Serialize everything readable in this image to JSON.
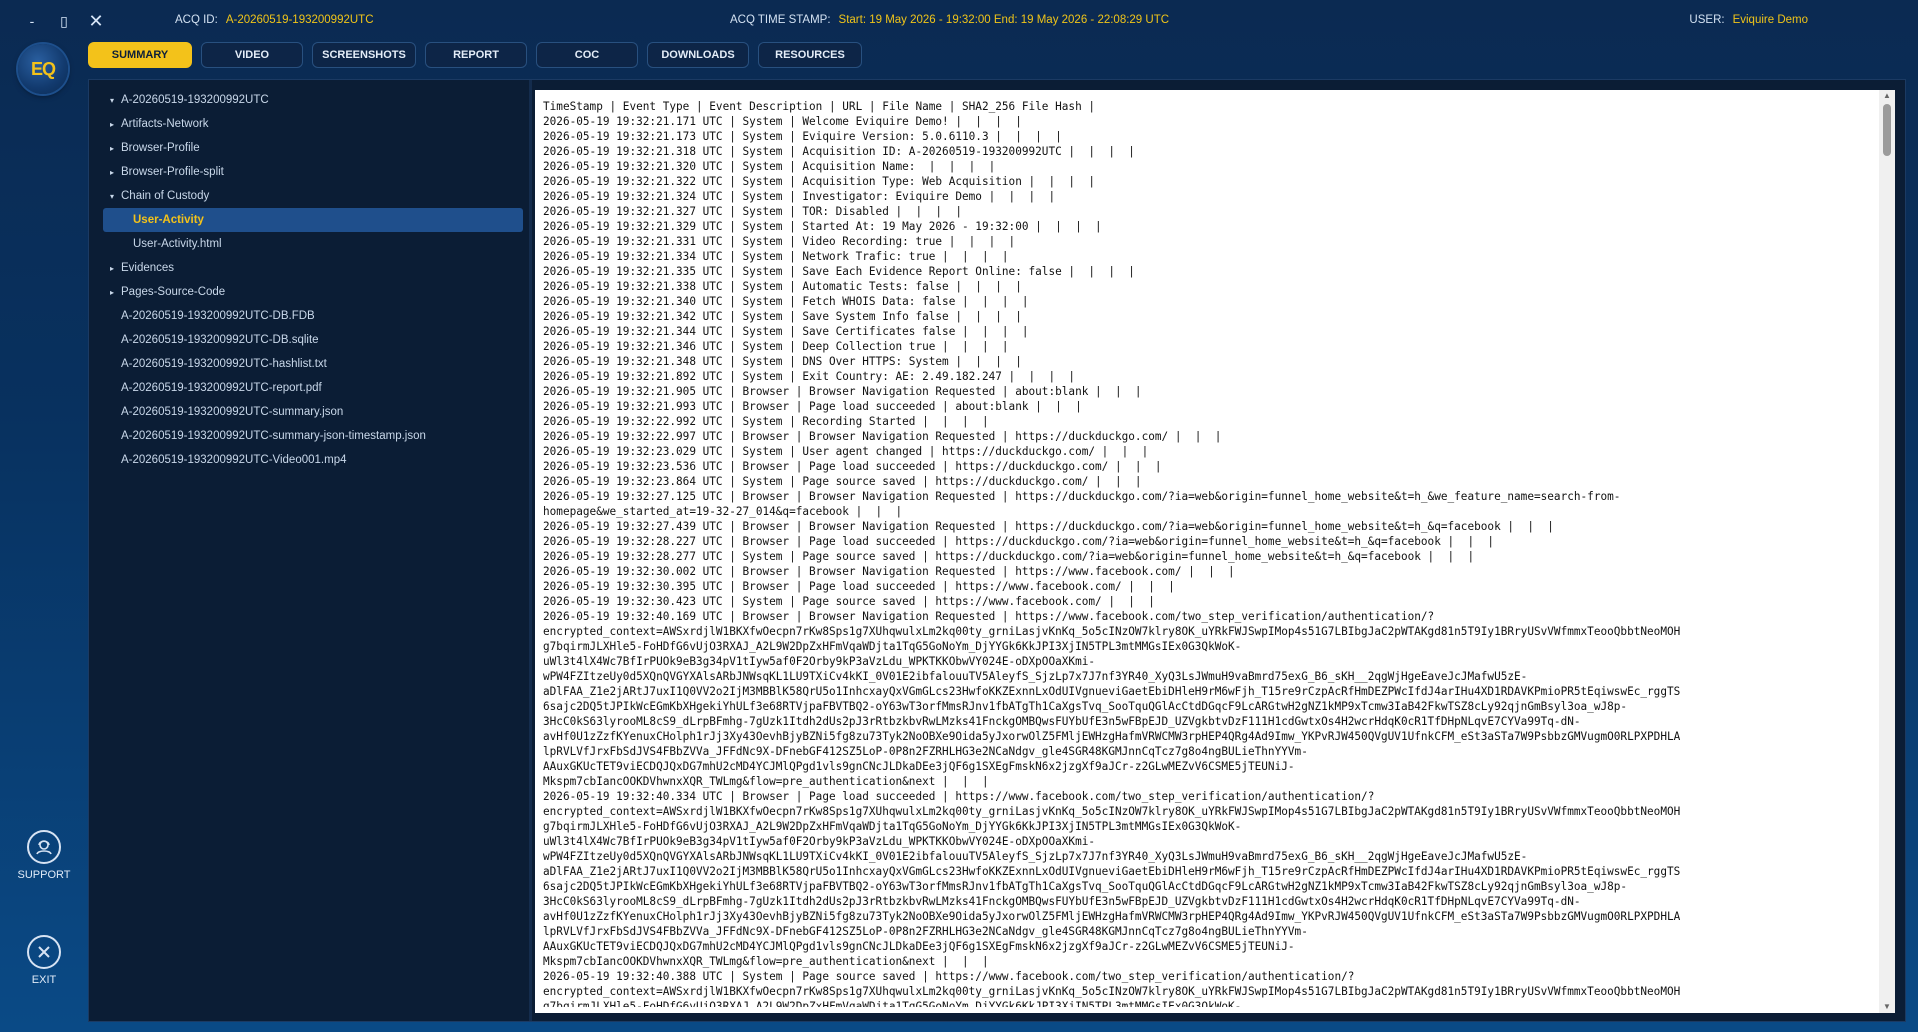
{
  "window": {
    "minimize": "-",
    "restore": "▯",
    "close": "✕"
  },
  "header": {
    "acq_label": "ACQ ID:",
    "acq_value": "A-20260519-193200992UTC",
    "ts_label": "ACQ TIME STAMP:",
    "ts_value": "Start: 19 May 2026 - 19:32:00 End: 19 May 2026 - 22:08:29 UTC",
    "user_label": "USER:",
    "user_value": "Eviquire Demo"
  },
  "logo": {
    "text": "EQ"
  },
  "tabs": [
    {
      "label": "SUMMARY",
      "active": true
    },
    {
      "label": "VIDEO"
    },
    {
      "label": "SCREENSHOTS"
    },
    {
      "label": "REPORT"
    },
    {
      "label": "COC"
    },
    {
      "label": "DOWNLOADS"
    },
    {
      "label": "RESOURCES"
    }
  ],
  "sidebar": {
    "support_label": "SUPPORT",
    "exit_label": "EXIT"
  },
  "tree": [
    {
      "label": "A-20260519-193200992UTC",
      "caret": "▾"
    },
    {
      "label": "Artifacts-Network",
      "caret": "▸"
    },
    {
      "label": "Browser-Profile",
      "caret": "▸"
    },
    {
      "label": "Browser-Profile-split",
      "caret": "▸"
    },
    {
      "label": "Chain of Custody",
      "caret": "▾"
    },
    {
      "label": "User-Activity",
      "child": true,
      "selected": true
    },
    {
      "label": "User-Activity.html",
      "child": true
    },
    {
      "label": "Evidences",
      "caret": "▸"
    },
    {
      "label": "Pages-Source-Code",
      "caret": "▸"
    },
    {
      "label": "A-20260519-193200992UTC-DB.FDB"
    },
    {
      "label": "A-20260519-193200992UTC-DB.sqlite"
    },
    {
      "label": "A-20260519-193200992UTC-hashlist.txt"
    },
    {
      "label": "A-20260519-193200992UTC-report.pdf"
    },
    {
      "label": "A-20260519-193200992UTC-summary.json"
    },
    {
      "label": "A-20260519-193200992UTC-summary-json-timestamp.json"
    },
    {
      "label": "A-20260519-193200992UTC-Video001.mp4"
    }
  ],
  "log_lines": [
    "TimeStamp | Event Type | Event Description | URL | File Name | SHA2_256 File Hash |",
    "2026-05-19 19:32:21.171 UTC | System | Welcome Eviquire Demo! |  |  |  |",
    "2026-05-19 19:32:21.173 UTC | System | Eviquire Version: 5.0.6110.3 |  |  |  |",
    "2026-05-19 19:32:21.318 UTC | System | Acquisition ID: A-20260519-193200992UTC |  |  |  |",
    "2026-05-19 19:32:21.320 UTC | System | Acquisition Name:  |  |  |  |",
    "2026-05-19 19:32:21.322 UTC | System | Acquisition Type: Web Acquisition |  |  |  |",
    "2026-05-19 19:32:21.324 UTC | System | Investigator: Eviquire Demo |  |  |  |",
    "2026-05-19 19:32:21.327 UTC | System | TOR: Disabled |  |  |  |",
    "2026-05-19 19:32:21.329 UTC | System | Started At: 19 May 2026 - 19:32:00 |  |  |  |",
    "2026-05-19 19:32:21.331 UTC | System | Video Recording: true |  |  |  |",
    "2026-05-19 19:32:21.334 UTC | System | Network Trafic: true |  |  |  |",
    "2026-05-19 19:32:21.335 UTC | System | Save Each Evidence Report Online: false |  |  |  |",
    "2026-05-19 19:32:21.338 UTC | System | Automatic Tests: false |  |  |  |",
    "2026-05-19 19:32:21.340 UTC | System | Fetch WHOIS Data: false |  |  |  |",
    "2026-05-19 19:32:21.342 UTC | System | Save System Info false |  |  |  |",
    "2026-05-19 19:32:21.344 UTC | System | Save Certificates false |  |  |  |",
    "2026-05-19 19:32:21.346 UTC | System | Deep Collection true |  |  |  |",
    "2026-05-19 19:32:21.348 UTC | System | DNS Over HTTPS: System |  |  |  |",
    "2026-05-19 19:32:21.892 UTC | System | Exit Country: AE: 2.49.182.247 |  |  |  |",
    "2026-05-19 19:32:21.905 UTC | Browser | Browser Navigation Requested | about:blank |  |  |",
    "2026-05-19 19:32:21.993 UTC | Browser | Page load succeeded | about:blank |  |  |",
    "2026-05-19 19:32:22.992 UTC | System | Recording Started |  |  |  |",
    "2026-05-19 19:32:22.997 UTC | Browser | Browser Navigation Requested | https://duckduckgo.com/ |  |  |",
    "2026-05-19 19:32:23.029 UTC | System | User agent changed | https://duckduckgo.com/ |  |  |",
    "2026-05-19 19:32:23.536 UTC | Browser | Page load succeeded | https://duckduckgo.com/ |  |  |",
    "2026-05-19 19:32:23.864 UTC | System | Page source saved | https://duckduckgo.com/ |  |  |",
    "2026-05-19 19:32:27.125 UTC | Browser | Browser Navigation Requested | https://duckduckgo.com/?ia=web&origin=funnel_home_website&t=h_&we_feature_name=search-from-",
    "homepage&we_started_at=19-32-27_014&q=facebook |  |  |",
    "2026-05-19 19:32:27.439 UTC | Browser | Browser Navigation Requested | https://duckduckgo.com/?ia=web&origin=funnel_home_website&t=h_&q=facebook |  |  |",
    "2026-05-19 19:32:28.227 UTC | Browser | Page load succeeded | https://duckduckgo.com/?ia=web&origin=funnel_home_website&t=h_&q=facebook |  |  |",
    "2026-05-19 19:32:28.277 UTC | System | Page source saved | https://duckduckgo.com/?ia=web&origin=funnel_home_website&t=h_&q=facebook |  |  |",
    "2026-05-19 19:32:30.002 UTC | Browser | Browser Navigation Requested | https://www.facebook.com/ |  |  |",
    "2026-05-19 19:32:30.395 UTC | Browser | Page load succeeded | https://www.facebook.com/ |  |  |",
    "2026-05-19 19:32:30.423 UTC | System | Page source saved | https://www.facebook.com/ |  |  |",
    "2026-05-19 19:32:40.169 UTC | Browser | Browser Navigation Requested | https://www.facebook.com/two_step_verification/authentication/?",
    "encrypted_context=AWSxrdjlW1BKXfwOecpn7rKw8Sps1g7XUhqwulxLm2kq00ty_grniLasjvKnKq_5o5cINzOW7klry8OK_uYRkFWJSwpIMop4s51G7LBIbgJaC2pWTAKgd81n5T9Iy1BRryUSvVWfmmxTeooQbbtNeoMOH",
    "g7bqirmJLXHle5-FoHDfG6vUjO3RXAJ_A2L9W2DpZxHFmVqaWDjta1TqG5GoNoYm_DjYYGk6KkJPI3XjIN5TPL3mtMMGsIEx0G3QkWoK-",
    "uWl3t4lX4Wc7BfIrPUOk9eB3g34pV1tIyw5af0F2Orby9kP3aVzLdu_WPKTKKObwVY024E-oDXpOOaXKmi-",
    "wPW4FZItzeUy0d5XQnQVGYXAlsARbJNWsqKL1LU9TXiCv4kKI_0V01E2ibfalouuTV5AleyfS_SjzLp7x7J7nf3YR40_XyQ3LsJWmuH9vaBmrd75exG_B6_sKH__2qgWjHgeEaveJcJMafwU5zE-",
    "aDlFAA_Z1e2jARtJ7uxI1Q0VV2o2IjM3MBBlK58QrU5o1InhcxayQxVGmGLcs23HwfoKKZExnnLxOdUIVgnueviGaetEbiDHleH9rM6wFjh_T15re9rCzpAcRfHmDEZPWcIfdJ4arIHu4XD1RDAVKPmioPR5tEqiwswEc_rggTS",
    "6sajc2DQ5tJPIkWcEGmKbXHgekiYhULf3e68RTVjpaFBVTBQ2-oY63wT3orfMmsRJnv1fbATgTh1CaXgsTvq_SooTquQGlAcCtdDGqcF9LcARGtwH2gNZ1kMP9xTcmw3IaB42FkwTSZ8cLy92qjnGmBsyl3oa_wJ8p-",
    "3HcC0kS63lyrooML8cS9_dLrpBFmhg-7gUzk1Itdh2dUs2pJ3rRtbzkbvRwLMzks41FnckgOMBQwsFUYbUfE3n5wFBpEJD_UZVgkbtvDzF111H1cdGwtxOs4H2wcrHdqK0cR1TfDHpNLqvE7CYVa99Tq-dN-",
    "avHf0U1zZzfKYenuxCHolph1rJj3Xy43OevhBjyBZNi5fg8zu73Tyk2NoOBXe9Oida5yJxorwOlZ5FMljEWHzgHafmVRWCMW3rpHEP4QRg4Ad9Imw_YKPvRJW450QVgUV1UfnkCFM_eSt3aSTa7W9PsbbzGMVugmO0RLPXPDHLA",
    "lpRVLVfJrxFbSdJVS4FBbZVVa_JFFdNc9X-DFnebGF412SZ5LoP-0P8n2FZRHLHG3e2NCaNdgv_gle4SGR48KGMJnnCqTcz7g8o4ngBULieThnYYVm-",
    "AAuxGKUcTET9viECDQJQxDG7mhU2cMD4YCJMlQPgd1vls9gnCNcJLDkaDEe3jQF6g1SXEgFmskN6x2jzgXf9aJCr-z2GLwMEZvV6CSME5jTEUNiJ-",
    "Mkspm7cbIancOOKDVhwnxXQR_TWLmg&flow=pre_authentication&next |  |  |",
    "2026-05-19 19:32:40.334 UTC | Browser | Page load succeeded | https://www.facebook.com/two_step_verification/authentication/?",
    "encrypted_context=AWSxrdjlW1BKXfwOecpn7rKw8Sps1g7XUhqwulxLm2kq00ty_grniLasjvKnKq_5o5cINzOW7klry8OK_uYRkFWJSwpIMop4s51G7LBIbgJaC2pWTAKgd81n5T9Iy1BRryUSvVWfmmxTeooQbbtNeoMOH",
    "g7bqirmJLXHle5-FoHDfG6vUjO3RXAJ_A2L9W2DpZxHFmVqaWDjta1TqG5GoNoYm_DjYYGk6KkJPI3XjIN5TPL3mtMMGsIEx0G3QkWoK-",
    "uWl3t4lX4Wc7BfIrPUOk9eB3g34pV1tIyw5af0F2Orby9kP3aVzLdu_WPKTKKObwVY024E-oDXpOOaXKmi-",
    "wPW4FZItzeUy0d5XQnQVGYXAlsARbJNWsqKL1LU9TXiCv4kKI_0V01E2ibfalouuTV5AleyfS_SjzLp7x7J7nf3YR40_XyQ3LsJWmuH9vaBmrd75exG_B6_sKH__2qgWjHgeEaveJcJMafwU5zE-",
    "aDlFAA_Z1e2jARtJ7uxI1Q0VV2o2IjM3MBBlK58QrU5o1InhcxayQxVGmGLcs23HwfoKKZExnnLxOdUIVgnueviGaetEbiDHleH9rM6wFjh_T15re9rCzpAcRfHmDEZPWcIfdJ4arIHu4XD1RDAVKPmioPR5tEqiwswEc_rggTS",
    "6sajc2DQ5tJPIkWcEGmKbXHgekiYhULf3e68RTVjpaFBVTBQ2-oY63wT3orfMmsRJnv1fbATgTh1CaXgsTvq_SooTquQGlAcCtdDGqcF9LcARGtwH2gNZ1kMP9xTcmw3IaB42FkwTSZ8cLy92qjnGmBsyl3oa_wJ8p-",
    "3HcC0kS63lyrooML8cS9_dLrpBFmhg-7gUzk1Itdh2dUs2pJ3rRtbzkbvRwLMzks41FnckgOMBQwsFUYbUfE3n5wFBpEJD_UZVgkbtvDzF111H1cdGwtxOs4H2wcrHdqK0cR1TfDHpNLqvE7CYVa99Tq-dN-",
    "avHf0U1zZzfKYenuxCHolph1rJj3Xy43OevhBjyBZNi5fg8zu73Tyk2NoOBXe9Oida5yJxorwOlZ5FMljEWHzgHafmVRWCMW3rpHEP4QRg4Ad9Imw_YKPvRJW450QVgUV1UfnkCFM_eSt3aSTa7W9PsbbzGMVugmO0RLPXPDHLA",
    "lpRVLVfJrxFbSdJVS4FBbZVVa_JFFdNc9X-DFnebGF412SZ5LoP-0P8n2FZRHLHG3e2NCaNdgv_gle4SGR48KGMJnnCqTcz7g8o4ngBULieThnYYVm-",
    "AAuxGKUcTET9viECDQJQxDG7mhU2cMD4YCJMlQPgd1vls9gnCNcJLDkaDEe3jQF6g1SXEgFmskN6x2jzgXf9aJCr-z2GLwMEZvV6CSME5jTEUNiJ-",
    "Mkspm7cbIancOOKDVhwnxXQR_TWLmg&flow=pre_authentication&next |  |  |",
    "2026-05-19 19:32:40.388 UTC | System | Page source saved | https://www.facebook.com/two_step_verification/authentication/?",
    "encrypted_context=AWSxrdjlW1BKXfwOecpn7rKw8Sps1g7XUhqwulxLm2kq00ty_grniLasjvKnKq_5o5cINzOW7klry8OK_uYRkFWJSwpIMop4s51G7LBIbgJaC2pWTAKgd81n5T9Iy1BRryUSvVWfmmxTeooQbbtNeoMOH",
    "g7bqirmJLXHle5-FoHDfG6vUjO3RXAJ_A2L9W2DpZxHFmVqaWDjta1TqG5GoNoYm_DjYYGk6KkJPI3XjIN5TPL3mtMMGsIEx0G3QkWoK-"
  ]
}
